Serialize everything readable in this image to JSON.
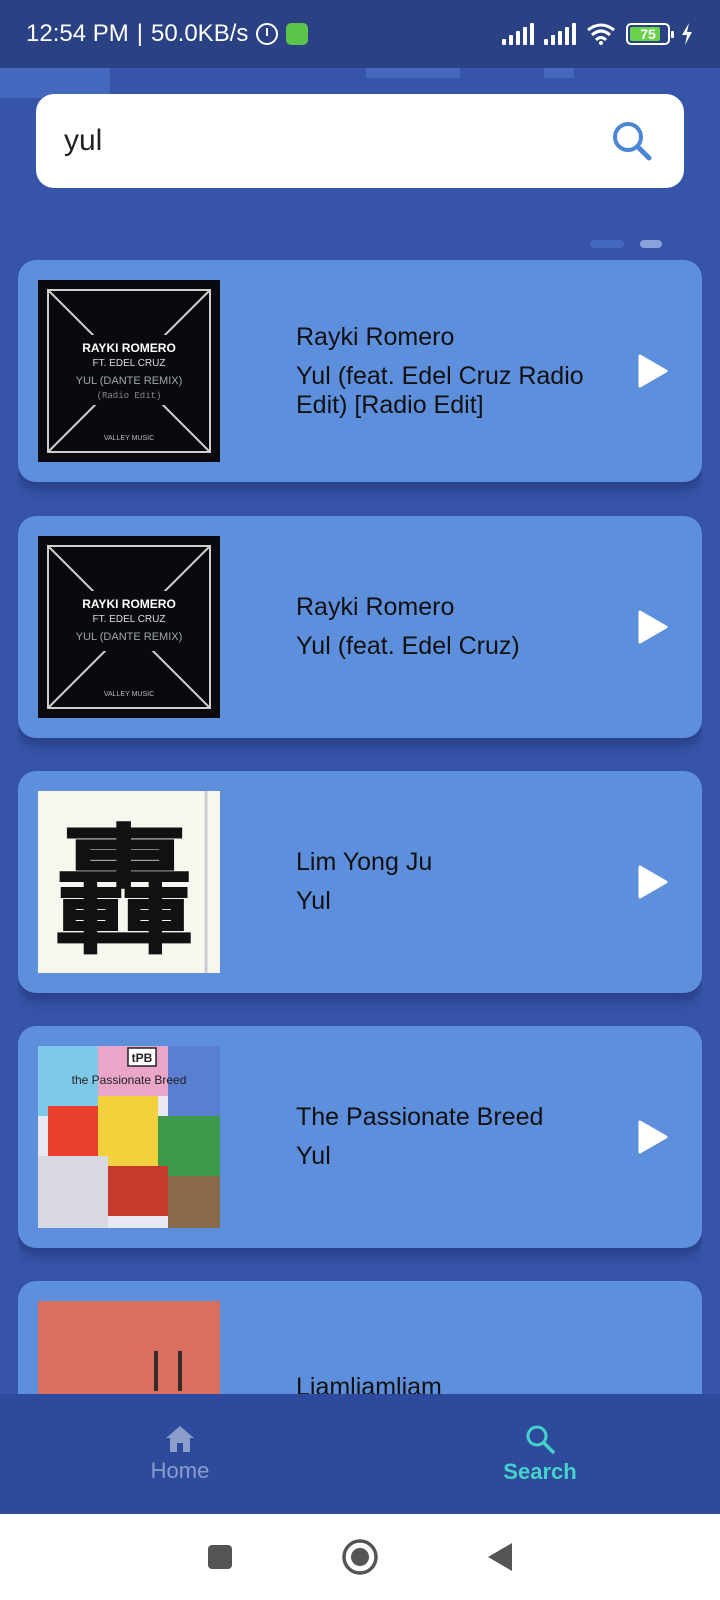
{
  "status_bar": {
    "time": "12:54 PM",
    "speed": "50.0KB/s",
    "battery": "75",
    "icons": [
      "alarm-icon",
      "app-badge-icon",
      "signal-icon",
      "signal-icon",
      "wifi-icon",
      "battery-icon",
      "charging-icon"
    ]
  },
  "search": {
    "value": "yul",
    "icon": "search-icon"
  },
  "results": [
    {
      "artist": "Rayki Romero",
      "title": "Yul (feat. Edel Cruz Radio Edit) [Radio Edit]",
      "cover": "rayki-romero-cover"
    },
    {
      "artist": "Rayki Romero",
      "title": "Yul (feat. Edel Cruz)",
      "cover": "rayki-romero-cover"
    },
    {
      "artist": "Lim Yong Ju",
      "title": "Yul",
      "cover": "chinese-character-cover"
    },
    {
      "artist": "The Passionate Breed",
      "title": "Yul",
      "cover": "tpb-cover",
      "cover_text": "tPB",
      "cover_subtitle": "the Passionate Breed"
    },
    {
      "artist": "Liamliamliam",
      "title": "",
      "cover": "salmon-cover"
    }
  ],
  "cover_text": {
    "rayki_line1": "RAYKI ROMERO",
    "rayki_line2": "FT. EDEL CRUZ",
    "rayki_line3": "YUL (DANTE REMIX)",
    "rayki_line4": "(Radio Edit)",
    "rayki_label": "VALLEY MUSIC",
    "lim_char": "轟"
  },
  "bottom_nav": {
    "home_label": "Home",
    "search_label": "Search"
  },
  "colors": {
    "background": "#3654a8",
    "card": "#5d8fdc",
    "active_nav": "#45d2c8",
    "inactive_nav": "#8a9ec9"
  }
}
